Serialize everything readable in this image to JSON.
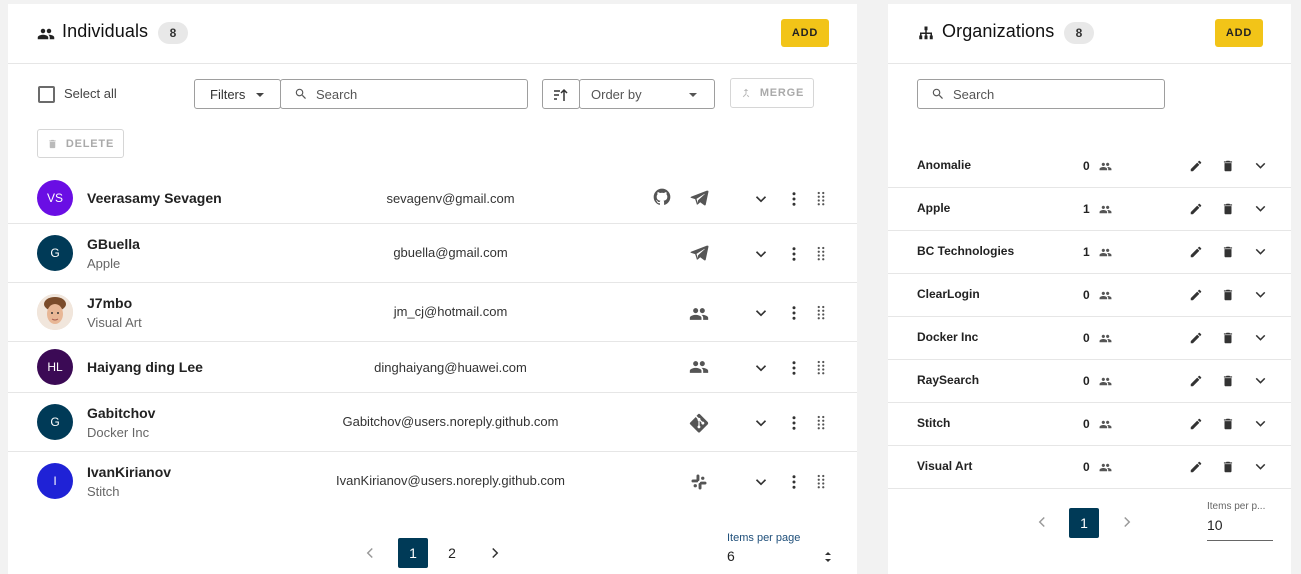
{
  "individuals": {
    "title": "Individuals",
    "count": "8",
    "add_label": "ADD",
    "select_all_label": "Select all",
    "filters_label": "Filters",
    "search_placeholder": "Search",
    "order_by_placeholder": "Order by",
    "merge_label": "MERGE",
    "delete_label": "DELETE",
    "rows": [
      {
        "initials": "VS",
        "name": "Veerasamy Sevagen",
        "org": "",
        "email": "sevagenv@gmail.com",
        "avatar_color": "#6a0ee4",
        "icons": [
          "github-icon",
          "telegram-icon"
        ]
      },
      {
        "initials": "G",
        "name": "GBuella",
        "org": "Apple",
        "email": "gbuella@gmail.com",
        "avatar_color": "#003a57",
        "icons": [
          "telegram-icon"
        ]
      },
      {
        "initials": "",
        "name": "J7mbo",
        "org": "Visual Art",
        "email": "jm_cj@hotmail.com",
        "avatar_color": "photo",
        "icons": [
          "people-icon"
        ]
      },
      {
        "initials": "HL",
        "name": "Haiyang ding Lee",
        "org": "",
        "email": "dinghaiyang@huawei.com",
        "avatar_color": "#3b0a55",
        "icons": [
          "people-icon"
        ]
      },
      {
        "initials": "G",
        "name": "Gabitchov",
        "org": "Docker Inc",
        "email": "Gabitchov@users.noreply.github.com",
        "avatar_color": "#003a57",
        "icons": [
          "git-icon"
        ]
      },
      {
        "initials": "I",
        "name": "IvanKirianov",
        "org": "Stitch",
        "email": "IvanKirianov@users.noreply.github.com",
        "avatar_color": "#1f22d6",
        "icons": [
          "slack-icon"
        ]
      }
    ],
    "pagination": {
      "pages": [
        "1",
        "2"
      ],
      "current": "1",
      "items_per_page_label": "Items per page",
      "items_per_page": "6"
    }
  },
  "organizations": {
    "title": "Organizations",
    "count": "8",
    "add_label": "ADD",
    "search_placeholder": "Search",
    "rows": [
      {
        "name": "Anomalie",
        "members": "0"
      },
      {
        "name": "Apple",
        "members": "1"
      },
      {
        "name": "BC Technologies",
        "members": "1"
      },
      {
        "name": "ClearLogin",
        "members": "0"
      },
      {
        "name": "Docker Inc",
        "members": "0"
      },
      {
        "name": "RaySearch",
        "members": "0"
      },
      {
        "name": "Stitch",
        "members": "0"
      },
      {
        "name": "Visual Art",
        "members": "0"
      }
    ],
    "pagination": {
      "current": "1",
      "items_per_page_label": "Items per p...",
      "items_per_page": "10"
    }
  },
  "colors": {
    "accent": "#f2c418",
    "primary": "#003a57"
  }
}
